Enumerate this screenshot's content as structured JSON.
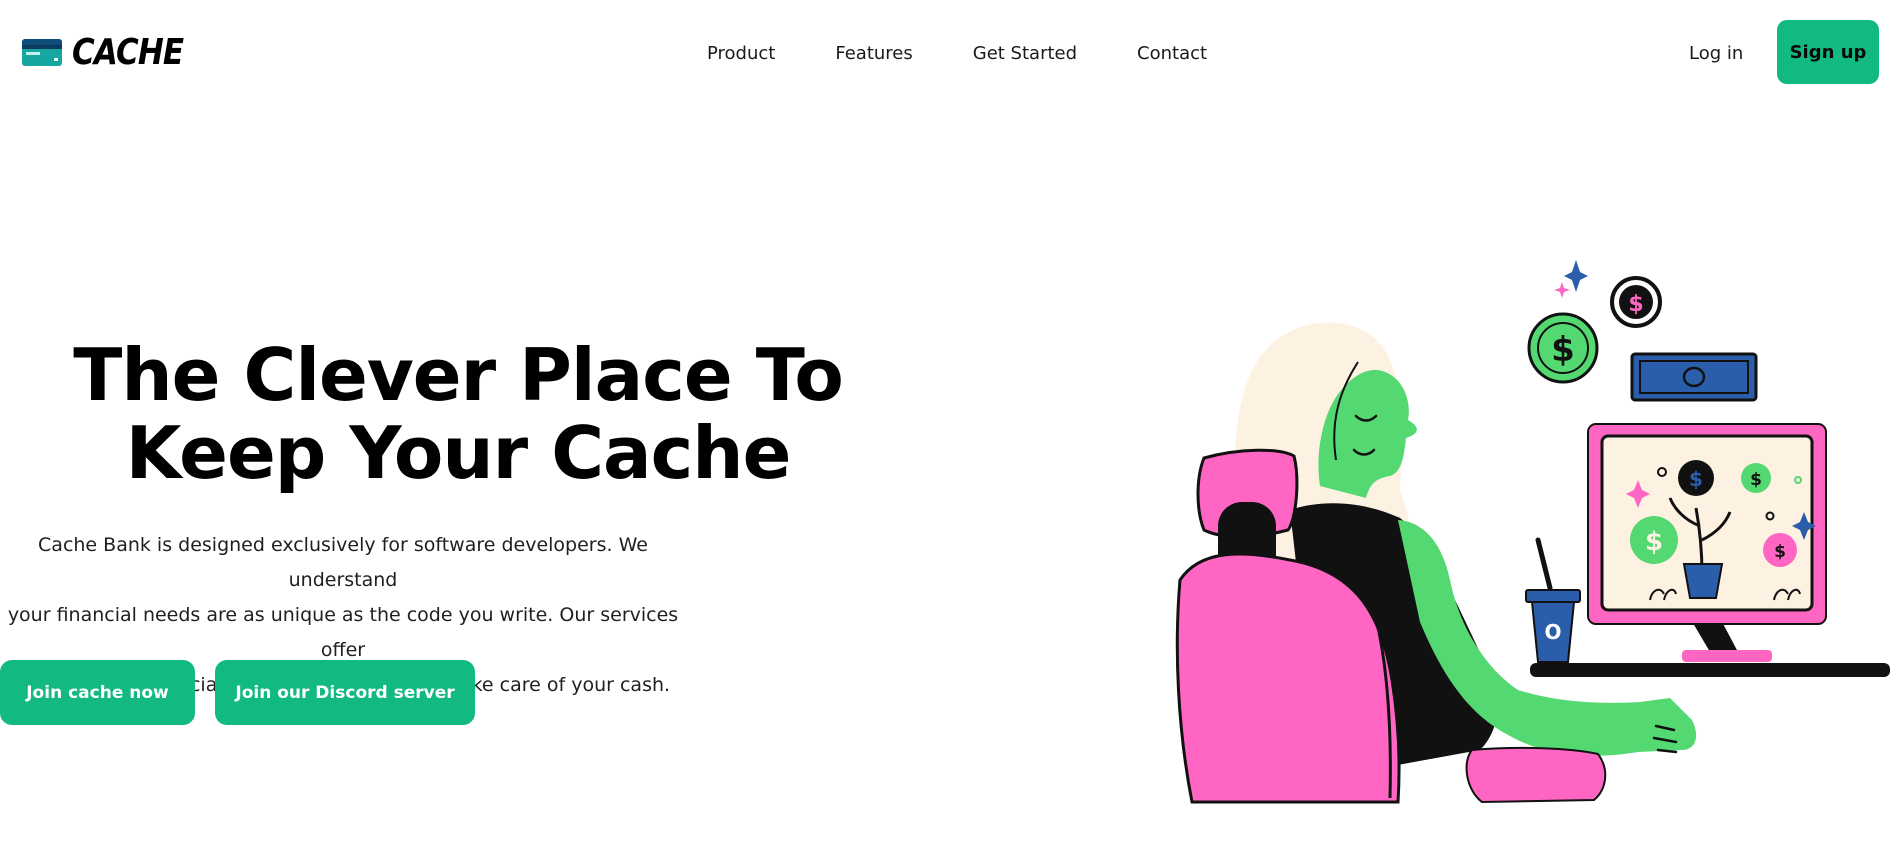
{
  "brand": {
    "name": "CACHE",
    "icon": "credit-card-icon"
  },
  "nav": {
    "links": [
      "Product",
      "Features",
      "Get Started",
      "Contact"
    ],
    "login_label": "Log in",
    "signup_label": "Sign up"
  },
  "hero": {
    "title_line1": "The Clever Place To",
    "title_line2": "Keep Your Cache",
    "description_line1": "Cache Bank is designed exclusively for software developers. We understand",
    "description_line2": "your financial needs are as unique as the code you write. Our services offer",
    "description_line3": "cutting edge financial solutions that help you take care of your cash.",
    "cta_primary": "Join cache now",
    "cta_secondary": "Join our Discord server"
  },
  "illustration": {
    "cup_label": "O",
    "coin_symbol": "$"
  },
  "colors": {
    "accent": "#12b981",
    "pink": "#ff66c4",
    "green": "#54d872",
    "blue": "#2a5eab",
    "cream": "#fdf1e2"
  }
}
